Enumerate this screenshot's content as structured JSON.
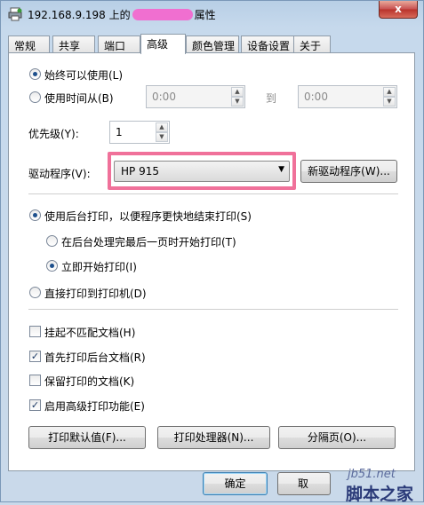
{
  "window": {
    "title_prefix": "192.168.9.198 上的",
    "title_suffix": "属性",
    "close_label": "x"
  },
  "tabs": [
    {
      "label": "常规"
    },
    {
      "label": "共享"
    },
    {
      "label": "端口"
    },
    {
      "label": "高级",
      "active": true
    },
    {
      "label": "颜色管理"
    },
    {
      "label": "设备设置"
    },
    {
      "label": "关于"
    }
  ],
  "availability": {
    "always_label": "始终可以使用(L)",
    "from_label": "使用时间从(B)",
    "from_time": "0:00",
    "to_label": "到",
    "to_time": "0:00"
  },
  "priority": {
    "label": "优先级(Y):",
    "value": "1"
  },
  "driver": {
    "label": "驱动程序(V):",
    "value": "HP 915",
    "new_driver_button": "新驱动程序(W)..."
  },
  "spool": {
    "spool_label": "使用后台打印，以便程序更快地结束打印(S)",
    "after_last_label": "在后台处理完最后一页时开始打印(T)",
    "immediately_label": "立即开始打印(I)",
    "direct_label": "直接打印到打印机(D)"
  },
  "options": [
    {
      "label": "挂起不匹配文档(H)",
      "checked": false
    },
    {
      "label": "首先打印后台文档(R)",
      "checked": true
    },
    {
      "label": "保留打印的文档(K)",
      "checked": false
    },
    {
      "label": "启用高级打印功能(E)",
      "checked": true
    }
  ],
  "buttons": {
    "defaults": "打印默认值(F)...",
    "processor": "打印处理器(N)...",
    "separator": "分隔页(O)..."
  },
  "footer": {
    "ok": "确定",
    "cancel": "取"
  },
  "watermark": {
    "site": "jb51.net",
    "name": "脚本之家"
  },
  "colors": {
    "highlight": "#f0719a",
    "redaction": "#f06fd0",
    "accent": "#1d4f8c"
  }
}
